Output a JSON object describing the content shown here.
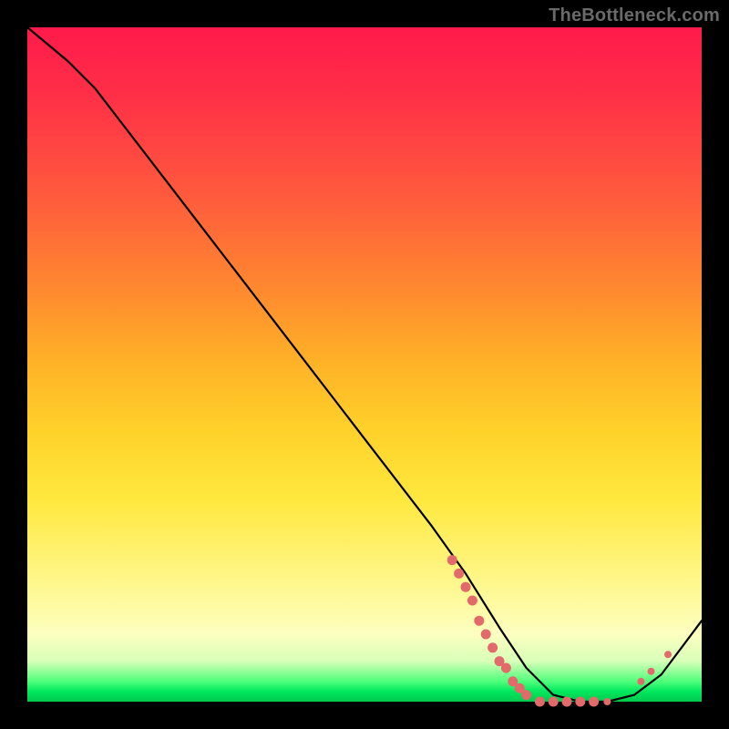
{
  "watermark": "TheBottleneck.com",
  "chart_data": {
    "type": "line",
    "title": "",
    "xlabel": "",
    "ylabel": "",
    "xlim": [
      0,
      100
    ],
    "ylim": [
      0,
      100
    ],
    "grid": false,
    "legend": false,
    "series": [
      {
        "name": "curve",
        "x": [
          0,
          6,
          10,
          20,
          30,
          40,
          50,
          60,
          65,
          70,
          74,
          78,
          82,
          86,
          90,
          94,
          100
        ],
        "y": [
          100,
          95,
          91,
          78,
          65,
          52,
          39,
          26,
          19,
          11,
          5,
          1,
          0,
          0,
          1,
          4,
          12
        ]
      }
    ],
    "markers": {
      "name": "dots",
      "color": "#e26a6a",
      "radius_large_range_x": [
        63,
        85
      ],
      "points": [
        {
          "x": 63,
          "y": 21
        },
        {
          "x": 64,
          "y": 19
        },
        {
          "x": 65,
          "y": 17
        },
        {
          "x": 66,
          "y": 15
        },
        {
          "x": 67,
          "y": 12
        },
        {
          "x": 68,
          "y": 10
        },
        {
          "x": 69,
          "y": 8
        },
        {
          "x": 70,
          "y": 6
        },
        {
          "x": 71,
          "y": 5
        },
        {
          "x": 72,
          "y": 3
        },
        {
          "x": 73,
          "y": 2
        },
        {
          "x": 74,
          "y": 1
        },
        {
          "x": 76,
          "y": 0
        },
        {
          "x": 78,
          "y": 0
        },
        {
          "x": 80,
          "y": 0
        },
        {
          "x": 82,
          "y": 0
        },
        {
          "x": 84,
          "y": 0
        },
        {
          "x": 86,
          "y": 0
        },
        {
          "x": 91,
          "y": 3
        },
        {
          "x": 92.5,
          "y": 4.5
        },
        {
          "x": 95,
          "y": 7
        }
      ]
    }
  }
}
